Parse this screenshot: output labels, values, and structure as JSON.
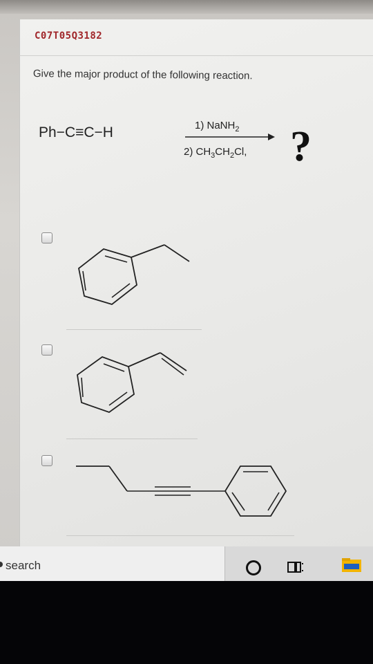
{
  "question": {
    "id": "C07T05Q3182",
    "prompt": "Give the major product of the following reaction."
  },
  "reaction": {
    "reactant": "Ph−C≡C−H",
    "step1": "1) NaNH",
    "step1_sub": "2",
    "step2_a": "2) CH",
    "step2_sub1": "3",
    "step2_b": "CH",
    "step2_sub2": "2",
    "step2_c": "Cl,",
    "product": "?"
  },
  "options": [
    {
      "id": "a",
      "label": "ethylbenzene",
      "checked": false
    },
    {
      "id": "b",
      "label": "styrene",
      "checked": false
    },
    {
      "id": "c",
      "label": "1-phenyl-1-butyne",
      "checked": false
    }
  ],
  "taskbar": {
    "search_text": "search",
    "icons": [
      "cortana-icon",
      "task-view-icon",
      "file-explorer-icon"
    ]
  },
  "colors": {
    "question_id": "#a0262a",
    "explorer_icon": "#f2b400"
  }
}
